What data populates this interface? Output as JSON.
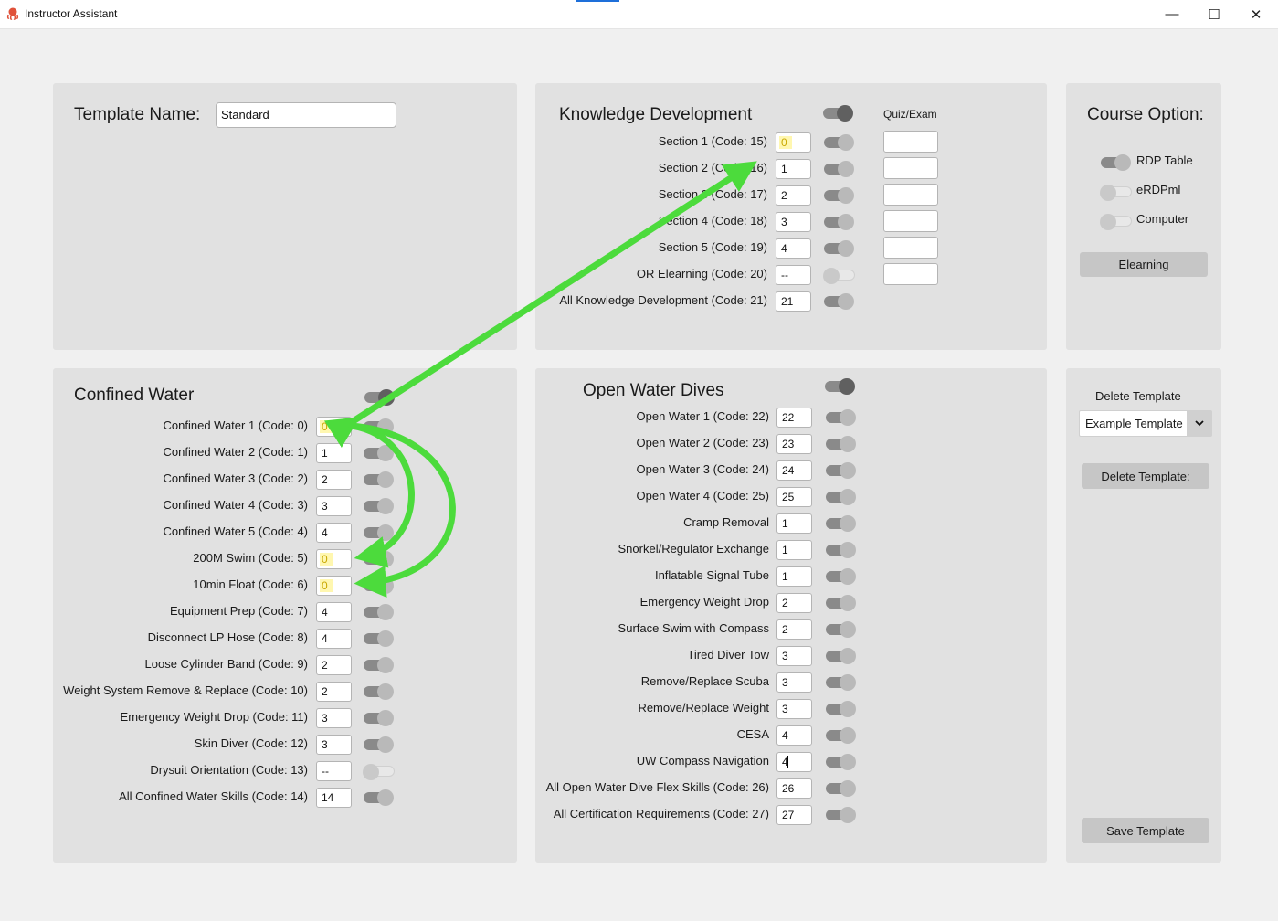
{
  "window": {
    "title": "Instructor Assistant",
    "controls": [
      "—",
      "☐",
      "✕"
    ]
  },
  "template": {
    "label": "Template Name:",
    "value": "Standard"
  },
  "knowledge": {
    "title": "Knowledge Development",
    "quiz_header": "Quiz/Exam",
    "rows": [
      {
        "label": "Section 1 (Code: 15)",
        "value": "0",
        "highlight": true
      },
      {
        "label": "Section 2 (Code: 16)",
        "value": "1"
      },
      {
        "label": "Section 3 (Code: 17)",
        "value": "2"
      },
      {
        "label": "Section 4 (Code: 18)",
        "value": "3"
      },
      {
        "label": "Section 5 (Code: 19)",
        "value": "4"
      },
      {
        "label": "OR Elearning (Code: 20)",
        "value": "--",
        "off": true
      },
      {
        "label": "All Knowledge Development (Code: 21)",
        "value": "21"
      }
    ]
  },
  "course": {
    "title": "Course Option:",
    "options": [
      {
        "label": "RDP Table",
        "on": true
      },
      {
        "label": "eRDPml",
        "on": false
      },
      {
        "label": "Computer",
        "on": false
      }
    ],
    "elearning_button": "Elearning"
  },
  "confined": {
    "title": "Confined Water",
    "rows": [
      {
        "label": "Confined Water 1 (Code: 0)",
        "value": "0",
        "highlight": true
      },
      {
        "label": "Confined Water 2 (Code: 1)",
        "value": "1"
      },
      {
        "label": "Confined Water 3 (Code: 2)",
        "value": "2"
      },
      {
        "label": "Confined Water 4 (Code: 3)",
        "value": "3"
      },
      {
        "label": "Confined Water 5 (Code: 4)",
        "value": "4"
      },
      {
        "label": "200M Swim (Code: 5)",
        "value": "0",
        "highlight": true
      },
      {
        "label": "10min Float (Code: 6)",
        "value": "0",
        "highlight": true
      },
      {
        "label": "Equipment Prep (Code: 7)",
        "value": "4"
      },
      {
        "label": "Disconnect LP Hose (Code: 8)",
        "value": "4"
      },
      {
        "label": "Loose Cylinder Band (Code: 9)",
        "value": "2"
      },
      {
        "label": "Weight System Remove & Replace (Code: 10)",
        "value": "2"
      },
      {
        "label": "Emergency Weight Drop (Code: 11)",
        "value": "3"
      },
      {
        "label": "Skin Diver (Code: 12)",
        "value": "3"
      },
      {
        "label": "Drysuit Orientation (Code: 13)",
        "value": "--",
        "off": true
      },
      {
        "label": "All Confined Water Skills (Code: 14)",
        "value": "14"
      }
    ]
  },
  "openwater": {
    "title": "Open Water Dives",
    "rows": [
      {
        "label": "Open Water 1 (Code: 22)",
        "value": "22"
      },
      {
        "label": "Open Water 2 (Code: 23)",
        "value": "23"
      },
      {
        "label": "Open Water 3 (Code: 24)",
        "value": "24"
      },
      {
        "label": "Open Water 4 (Code: 25)",
        "value": "25"
      },
      {
        "label": "Cramp Removal",
        "value": "1"
      },
      {
        "label": "Snorkel/Regulator Exchange",
        "value": "1"
      },
      {
        "label": "Inflatable Signal Tube",
        "value": "1"
      },
      {
        "label": "Emergency Weight Drop",
        "value": "2"
      },
      {
        "label": "Surface Swim with Compass",
        "value": "2"
      },
      {
        "label": "Tired Diver Tow",
        "value": "3"
      },
      {
        "label": "Remove/Replace Scuba",
        "value": "3"
      },
      {
        "label": "Remove/Replace Weight",
        "value": "3"
      },
      {
        "label": "CESA",
        "value": "4"
      },
      {
        "label": "UW Compass Navigation",
        "value": "4",
        "caret": true
      },
      {
        "label": "All Open Water Dive Flex Skills (Code: 26)",
        "value": "26"
      },
      {
        "label": "All Certification Requirements (Code: 27)",
        "value": "27"
      }
    ]
  },
  "manage": {
    "delete_label": "Delete Template",
    "dropdown_value": "Example Template",
    "delete_button": "Delete Template:",
    "save_button": "Save Template"
  },
  "colors": {
    "panel": "#e1e1e1",
    "background": "#f0f0f0",
    "annotation_arrow": "#4cdb3c",
    "highlight": "#fff7b0"
  }
}
